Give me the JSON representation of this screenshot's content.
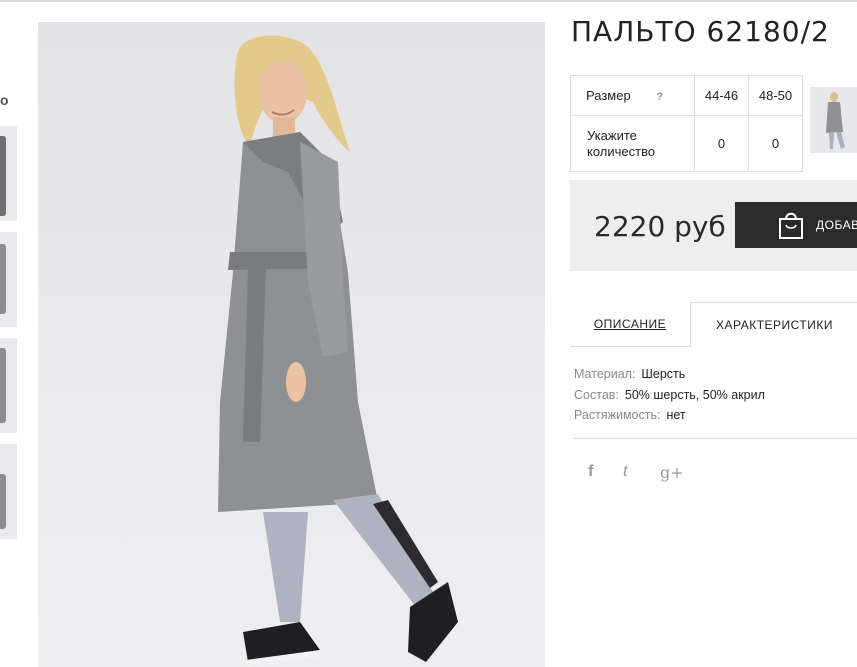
{
  "left_column": {
    "label": "о"
  },
  "product": {
    "title": "ПАЛЬТО 62180/2",
    "price": "2220 руб",
    "add_to_cart_label": "ДОБАВ"
  },
  "sizes": {
    "size_label": "Размер",
    "help_glyph": "?",
    "qty_label": "Укажите количество",
    "options": [
      {
        "size": "44-46",
        "qty": "0"
      },
      {
        "size": "48-50",
        "qty": "0"
      }
    ]
  },
  "tabs": {
    "description": "ОПИСАНИЕ",
    "characteristics": "ХАРАКТЕРИСТИКИ"
  },
  "specs": [
    {
      "key": "Материал:",
      "value": "Шерсть"
    },
    {
      "key": "Состав:",
      "value": "50% шерсть, 50% акрил"
    },
    {
      "key": "Растяжимость:",
      "value": "нет"
    }
  ],
  "social": {
    "facebook": "f",
    "twitter": "t",
    "gplus": "g+"
  },
  "colors": {
    "button_bg": "#2b2b2b",
    "price_bg": "#eeeeee",
    "coat": "#8f9093"
  }
}
